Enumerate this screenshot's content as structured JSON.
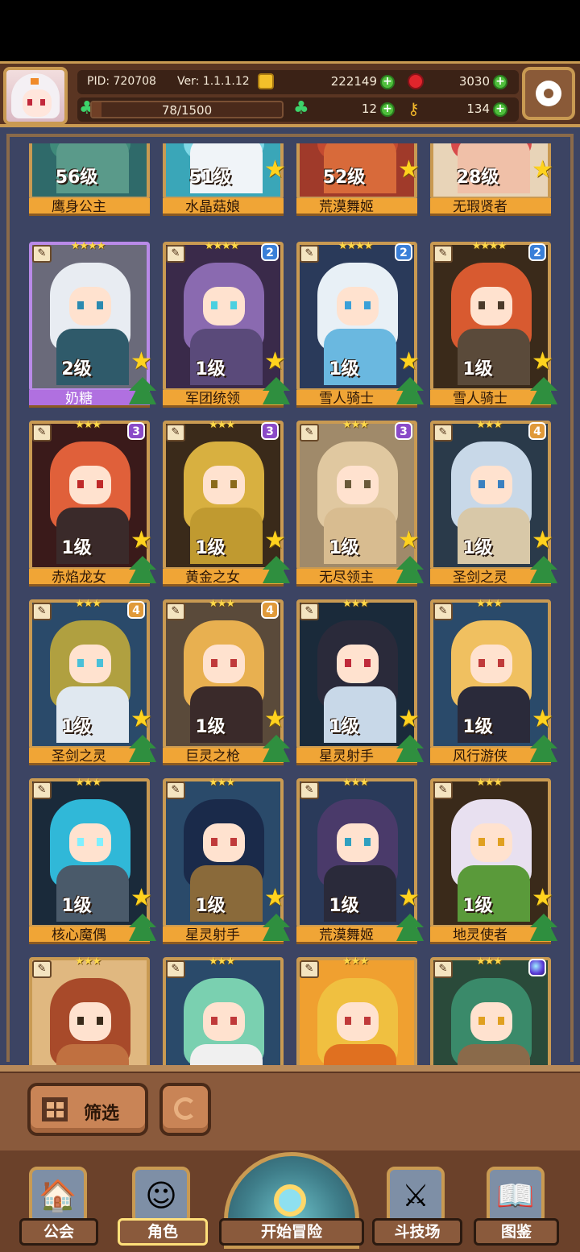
{
  "header": {
    "pid": "PID: 720708",
    "version": "Ver: 1.1.1.12",
    "gold": "222149",
    "gems": "3030",
    "stamina": "78/1500",
    "stamina_ratio": 0.052,
    "clover": "12",
    "keys": "134"
  },
  "cards_top_row": [
    {
      "level": "56级",
      "name": "鹰身公主",
      "colors": {
        "bg": "#2f6a6a",
        "hair": "#3f8a7a",
        "body": "#5a9a8a"
      }
    },
    {
      "level": "51级",
      "name": "水晶菇娘",
      "colors": {
        "bg": "#3aa6b8",
        "hair": "#7fd8e6",
        "body": "#f0f4f8"
      }
    },
    {
      "level": "52级",
      "name": "荒漠舞姬",
      "colors": {
        "bg": "#a03a2a",
        "hair": "#c44a30",
        "body": "#d86a3a"
      }
    },
    {
      "level": "28级",
      "name": "无瑕贤者",
      "colors": {
        "bg": "#e8d4b8",
        "hair": "#d84a4a",
        "body": "#f0c0a8"
      }
    }
  ],
  "cards": [
    {
      "level": "2级",
      "name": "奶糖",
      "stars": "★★★★",
      "badge": "",
      "purple": true,
      "colors": {
        "bg": "#6a6a7a",
        "hair": "#e8ecf2",
        "eye": "#2a8ab0",
        "body": "#2f5a6a"
      }
    },
    {
      "level": "1级",
      "name": "军团统领",
      "stars": "★★★★",
      "badge": "2",
      "badge_style": "blue",
      "colors": {
        "bg": "#3a2a4a",
        "hair": "#8a6ab0",
        "eye": "#4ad0e0",
        "body": "#5a4a7a"
      }
    },
    {
      "level": "1级",
      "name": "雪人骑士",
      "stars": "★★★★",
      "badge": "2",
      "badge_style": "blue",
      "colors": {
        "bg": "#2a3a5a",
        "hair": "#e8f0f6",
        "eye": "#3aa0d8",
        "body": "#6ab8e0"
      }
    },
    {
      "level": "1级",
      "name": "雪人骑士",
      "stars": "★★★★",
      "badge": "2",
      "badge_style": "blue",
      "colors": {
        "bg": "#3a2a1a",
        "hair": "#d85a30",
        "eye": "#4a3a2a",
        "body": "#5a4a3a"
      }
    },
    {
      "level": "1级",
      "name": "赤焰龙女",
      "stars": "★★★",
      "badge": "3",
      "badge_style": "purple",
      "colors": {
        "bg": "#3a1a1a",
        "hair": "#e0603a",
        "eye": "#c02a2a",
        "body": "#3a2a2a"
      }
    },
    {
      "level": "1级",
      "name": "黄金之女",
      "stars": "★★★",
      "badge": "3",
      "badge_style": "purple",
      "colors": {
        "bg": "#3a2a1a",
        "hair": "#d8b040",
        "eye": "#8a6a1a",
        "body": "#c09a30"
      }
    },
    {
      "level": "1级",
      "name": "无尽领主",
      "stars": "★★★",
      "badge": "3",
      "badge_style": "purple",
      "colors": {
        "bg": "#a08a6a",
        "hair": "#e0c8a0",
        "eye": "#6a5a3a",
        "body": "#d8bc90"
      }
    },
    {
      "level": "1级",
      "name": "圣剑之灵",
      "stars": "★★★",
      "badge": "4",
      "badge_style": "orange",
      "colors": {
        "bg": "#2a3a4a",
        "hair": "#c8d8e8",
        "eye": "#3a80c0",
        "body": "#d8c8a8"
      }
    },
    {
      "level": "1级",
      "name": "圣剑之灵",
      "stars": "★★★",
      "badge": "4",
      "badge_style": "orange",
      "colors": {
        "bg": "#2a4a6a",
        "hair": "#b0a040",
        "eye": "#4ac0d8",
        "body": "#e0e8f0"
      }
    },
    {
      "level": "1级",
      "name": "巨灵之枪",
      "stars": "★★★",
      "badge": "4",
      "badge_style": "orange",
      "colors": {
        "bg": "#5a4a3a",
        "hair": "#e8b050",
        "eye": "#c03a3a",
        "body": "#3a2a2a"
      }
    },
    {
      "level": "1级",
      "name": "星灵射手",
      "stars": "★★★",
      "badge": "",
      "colors": {
        "bg": "#1a2a3a",
        "hair": "#2a2a3a",
        "eye": "#c02a3a",
        "body": "#c8d8e8"
      }
    },
    {
      "level": "1级",
      "name": "风行游侠",
      "stars": "★★★",
      "badge": "",
      "colors": {
        "bg": "#2a4a6a",
        "hair": "#f0c060",
        "eye": "#c03a3a",
        "body": "#2a2a3a"
      }
    },
    {
      "level": "1级",
      "name": "核心魔偶",
      "stars": "★★★",
      "badge": "",
      "colors": {
        "bg": "#1a2a3a",
        "hair": "#30b8d8",
        "eye": "#80f0ff",
        "body": "#4a5a6a"
      }
    },
    {
      "level": "1级",
      "name": "星灵射手",
      "stars": "★★★",
      "badge": "",
      "colors": {
        "bg": "#2a4a6a",
        "hair": "#1a2a4a",
        "eye": "#c03a3a",
        "body": "#8a6a3a"
      }
    },
    {
      "level": "1级",
      "name": "荒漠舞姬",
      "stars": "★★★",
      "badge": "",
      "colors": {
        "bg": "#2a3a5a",
        "hair": "#4a3a6a",
        "eye": "#30a0c0",
        "body": "#2a2a3a"
      }
    },
    {
      "level": "1级",
      "name": "地灵使者",
      "stars": "★★★",
      "badge": "",
      "colors": {
        "bg": "#3a2a1a",
        "hair": "#e8e0f0",
        "eye": "#e0a020",
        "body": "#5a9a3a"
      }
    },
    {
      "level": "",
      "name": "",
      "stars": "★★★",
      "badge": "",
      "colors": {
        "bg": "#e0b880",
        "hair": "#a84a2a",
        "eye": "#3a2a1a",
        "body": "#c07040"
      }
    },
    {
      "level": "",
      "name": "",
      "stars": "★★★",
      "badge": "",
      "colors": {
        "bg": "#2a4a6a",
        "hair": "#7ad0b0",
        "eye": "#c03a3a",
        "body": "#f0f0f0"
      }
    },
    {
      "level": "",
      "name": "",
      "stars": "★★★",
      "badge": "",
      "colors": {
        "bg": "#f0a030",
        "hair": "#f0c040",
        "eye": "#c03a3a",
        "body": "#e07020"
      }
    },
    {
      "level": "",
      "name": "",
      "stars": "★★★",
      "badge": "",
      "badge_style": "orb",
      "colors": {
        "bg": "#2a4a3a",
        "hair": "#3a8a6a",
        "eye": "#e0a020",
        "body": "#8a6a4a"
      }
    }
  ],
  "bottom": {
    "filter_label": "筛选",
    "nav": [
      {
        "label": "公会",
        "icon": "guild-house-icon"
      },
      {
        "label": "角色",
        "icon": "character-icon"
      },
      {
        "label": "开始冒险",
        "icon": "adventure-magnifier-icon"
      },
      {
        "label": "斗技场",
        "icon": "arena-swords-icon"
      },
      {
        "label": "图鉴",
        "icon": "codex-book-icon"
      }
    ]
  }
}
